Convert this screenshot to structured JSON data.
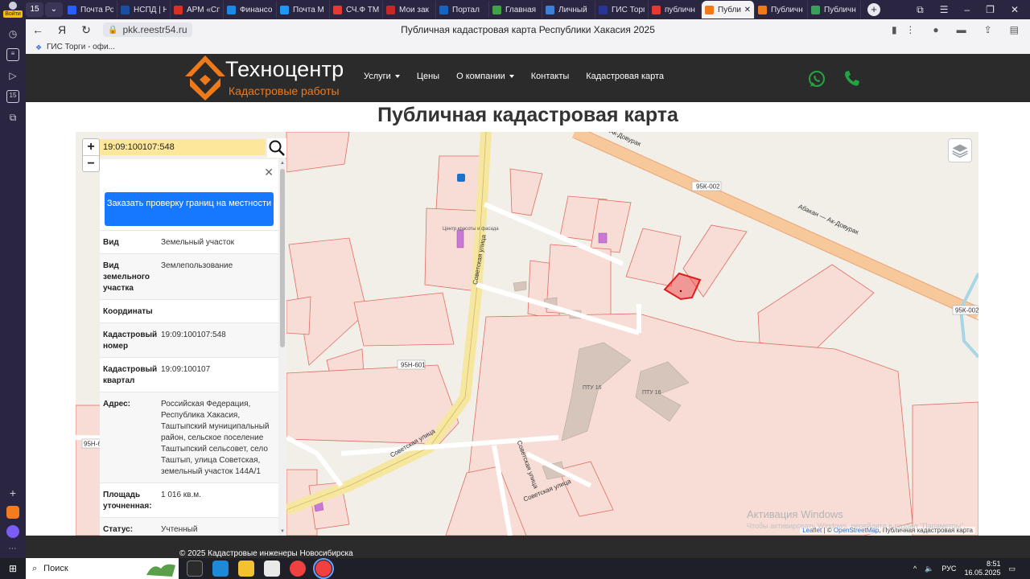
{
  "browser": {
    "login_label": "Войти",
    "tab_counter": "15",
    "tabs": [
      {
        "label": "Почта Ро",
        "color": "#2b5cff"
      },
      {
        "label": "НСПД | Н",
        "color": "#1a4fa0"
      },
      {
        "label": "АРМ «Сп",
        "color": "#d93025"
      },
      {
        "label": "Финансо",
        "color": "#1e88e5"
      },
      {
        "label": "Почта M",
        "color": "#2196f3"
      },
      {
        "label": "СЧ.Ф ТМ",
        "color": "#e53935"
      },
      {
        "label": "Мои зак",
        "color": "#c62828"
      },
      {
        "label": "Портал",
        "color": "#1565c0"
      },
      {
        "label": "Главная",
        "color": "#43a047"
      },
      {
        "label": "Личный",
        "color": "#3f7fd6"
      },
      {
        "label": "ГИС Торг",
        "color": "#283593"
      },
      {
        "label": "публичн",
        "color": "#e53935"
      },
      {
        "label": "Публи",
        "color": "#f07a1a",
        "active": true
      },
      {
        "label": "Публичн",
        "color": "#f07a1a"
      },
      {
        "label": "Публичн",
        "color": "#3c9d5c"
      }
    ],
    "url": "pkk.reestr54.ru",
    "page_title": "Публичная кадастровая карта Республики Хакасия 2025",
    "bookmark": "ГИС Торги - офи..."
  },
  "site": {
    "brand": "Техноцентр",
    "brand_sub": "Кадастровые работы",
    "menu": [
      {
        "label": "Услуги",
        "dropdown": true
      },
      {
        "label": "Цены",
        "dropdown": false
      },
      {
        "label": "О компании",
        "dropdown": true
      },
      {
        "label": "Контакты",
        "dropdown": false
      },
      {
        "label": "Кадастровая карта",
        "dropdown": false
      }
    ],
    "heading": "Публичная кадастровая карта",
    "footer": "© 2025 Кадастровые инженеры Новосибирска"
  },
  "map": {
    "search_value": "19:09:100107:548",
    "zoom_in": "+",
    "zoom_out": "−",
    "road_labels": [
      "95К-002",
      "95К-002",
      "Абакан — Ак-Довурак",
      "Абакан — Ак-Довурак",
      "Советская улица",
      "Советская улица",
      "Советская улица",
      "Советская улица",
      "95Н-601",
      "95Н-6"
    ],
    "building_labels": [
      "ПТУ 16",
      "ПТУ 16",
      "Центр красоты и фасада"
    ],
    "attribution": {
      "leaflet": "Leaflet",
      "osm": "OpenStreetMap",
      "rest": ", Публичная кадастровая карта"
    },
    "watermark_main": "Активация Windows",
    "watermark_sub": "Чтобы активировать Windows, перейдите в раздел \"Параметры\".",
    "panel": {
      "order_button": "Заказать проверку границ на местности",
      "rows": [
        {
          "k": "Вид",
          "v": "Земельный участок"
        },
        {
          "k": "Вид земельного участка",
          "v": "Землепользование"
        },
        {
          "k": "Координаты",
          "v": ""
        },
        {
          "k": "Кадастровый номер",
          "v": "19:09:100107:548"
        },
        {
          "k": "Кадастровый квартал",
          "v": "19:09:100107"
        },
        {
          "k": "Адрес:",
          "v": "Российская Федерация, Республика Хакасия, Таштыпский муниципальный район, сельское поселение Таштыпский сельсовет, село Таштып, улица Советская, земельный участок 144А/1"
        },
        {
          "k": "Площадь уточненная:",
          "v": "1 016 кв.м."
        },
        {
          "k": "Статус:",
          "v": "Учтенный"
        }
      ]
    }
  },
  "taskbar": {
    "search_label": "Поиск",
    "lang": "РУС",
    "time": "8:51",
    "date": "16.05.2025"
  },
  "colors": {
    "brand_orange": "#f07a1a",
    "header_bg": "#2b2b2b",
    "order_button": "#1677ff",
    "whatsapp_green": "#25a244",
    "search_bg": "#fde79a"
  }
}
